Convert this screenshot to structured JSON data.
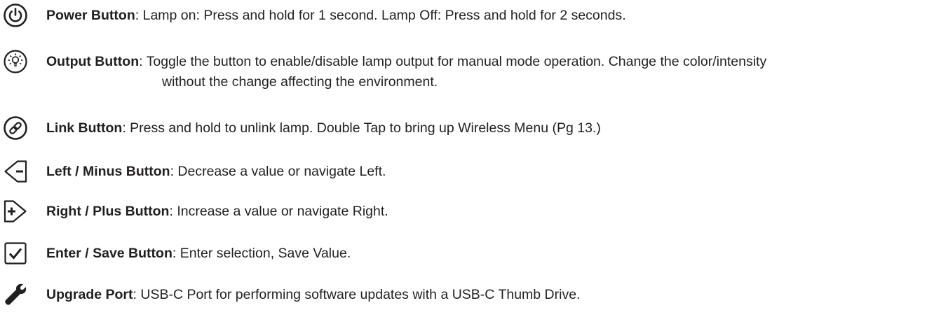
{
  "items": [
    {
      "icon": "power-icon",
      "title": "Power Button",
      "sep": ": ",
      "desc": "Lamp on: Press and hold for 1 second. Lamp Off: Press and hold for 2 seconds."
    },
    {
      "icon": "bulb-icon",
      "title": "Output Button",
      "sep": ": ",
      "desc": "Toggle the button to enable/disable lamp output for manual mode operation.  Change the color/intensity",
      "desc2": "without the change affecting the environment."
    },
    {
      "icon": "link-icon",
      "title": "Link Button",
      "sep": ": ",
      "desc": "Press and hold to unlink lamp. Double Tap to bring up Wireless Menu (Pg 13.)"
    },
    {
      "icon": "left-minus-icon",
      "title": "Left / Minus Button",
      "sep": ": ",
      "desc": "Decrease a value or navigate Left."
    },
    {
      "icon": "right-plus-icon",
      "title": "Right / Plus Button",
      "sep": ": ",
      "desc": "Increase a value or navigate Right."
    },
    {
      "icon": "checkmark-icon",
      "title": "Enter / Save Button",
      "sep": ": ",
      "desc": "Enter selection, Save Value."
    },
    {
      "icon": "wrench-icon",
      "title": "Upgrade Port",
      "sep": ": ",
      "desc": "USB-C Port for performing software updates with a USB-C Thumb Drive."
    }
  ]
}
